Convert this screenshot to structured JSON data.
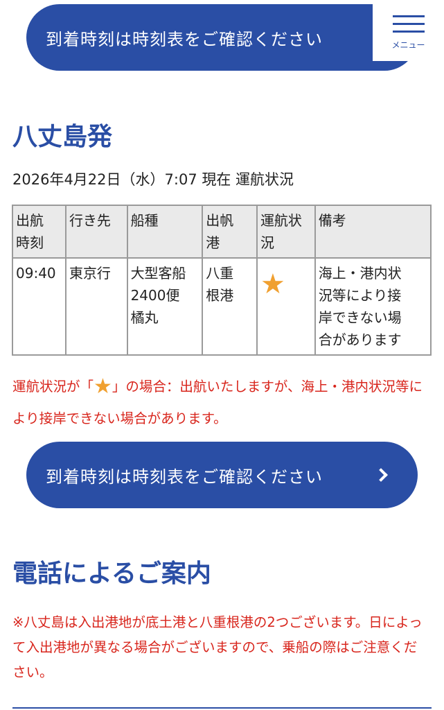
{
  "buttons": {
    "arrival_label": "到着時刻は時刻表をご確認ください"
  },
  "menu": {
    "label": "メニュー"
  },
  "departure": {
    "title": "八丈島発",
    "status_line": "2026年4月22日（水）7:07 現在 運航状況",
    "table": {
      "headers": [
        "出航\n時刻",
        "行き先",
        "船種",
        "出帆\n港",
        "運航状\n況",
        "備考"
      ],
      "rows": [
        {
          "time": "09:40",
          "destination": "東京行",
          "ship": "大型客船\n2400便\n橘丸",
          "port": "八重\n根港",
          "status_icon": "star-icon",
          "remarks": "海上・港内状\n況等により接\n岸できない場\n合があります"
        }
      ]
    },
    "star_note": {
      "before": "運航状況が「",
      "after": "」の場合：出航いたしますが、海上・港内状況等により接岸できない場合があります。"
    }
  },
  "telephone": {
    "title": "電話によるご案内",
    "note": "※八丈島は入出港地が底土港と八重根港の2つございます。日によって入出港地が異なる場合がございますので、乗船の際はご注意ください。"
  },
  "colors": {
    "brand_blue": "#2a4ea5",
    "notice_red": "#d8251c",
    "star_orange": "#f0a030"
  }
}
